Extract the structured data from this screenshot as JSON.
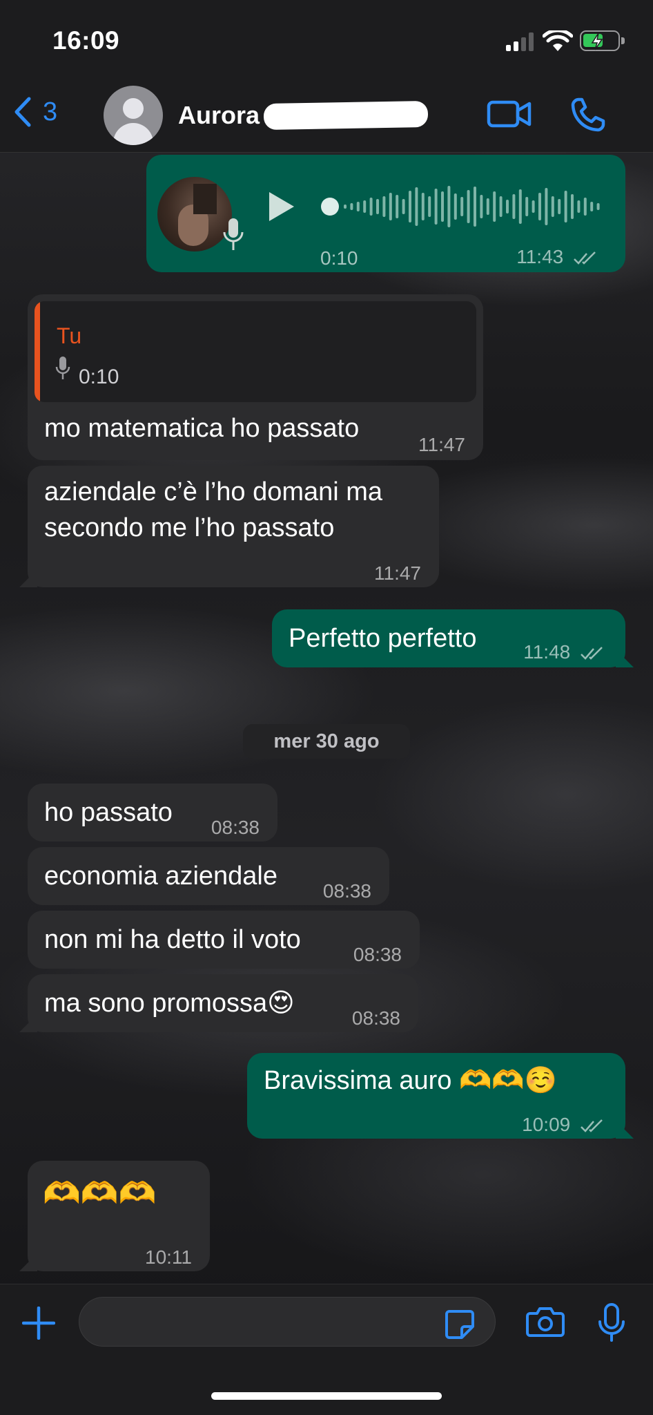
{
  "status_bar": {
    "time": "16:09"
  },
  "header": {
    "back_count": "3",
    "contact_name": "Aurora"
  },
  "messages": {
    "voice_out": {
      "duration": "0:10",
      "time": "11:43"
    },
    "reply_in": {
      "quote_author": "Tu",
      "quote_duration": "0:10",
      "text": "mo matematica ho passato",
      "time": "11:47"
    },
    "m2": {
      "line1": "aziendale c’è l’ho domani ma",
      "line2": "secondo me l’ho passato",
      "time": "11:47"
    },
    "m3": {
      "text": "Perfetto perfetto",
      "time": "11:48"
    },
    "date_separator": "mer 30 ago",
    "m4": {
      "text": "ho passato",
      "time": "08:38"
    },
    "m5": {
      "text": "economia aziendale",
      "time": "08:38"
    },
    "m6": {
      "text": "non mi ha detto il voto",
      "time": "08:38"
    },
    "m7": {
      "text": "ma sono promossa😍",
      "time": "08:38"
    },
    "m8": {
      "text": "Bravissima auro 🫶🫶☺️",
      "time": "10:09"
    },
    "m9": {
      "text": "🫶🫶🫶",
      "time": "10:11"
    }
  },
  "colors": {
    "accent": "#2f8cf5",
    "outgoing_bubble": "#005c4b",
    "incoming_bubble": "#2c2c2e",
    "quote_bar": "#e8531f"
  },
  "icons": [
    "chevron-left-icon",
    "video-camera-icon",
    "phone-icon",
    "play-icon",
    "mic-icon",
    "plus-icon",
    "sticker-icon",
    "camera-icon",
    "double-check-icon"
  ]
}
